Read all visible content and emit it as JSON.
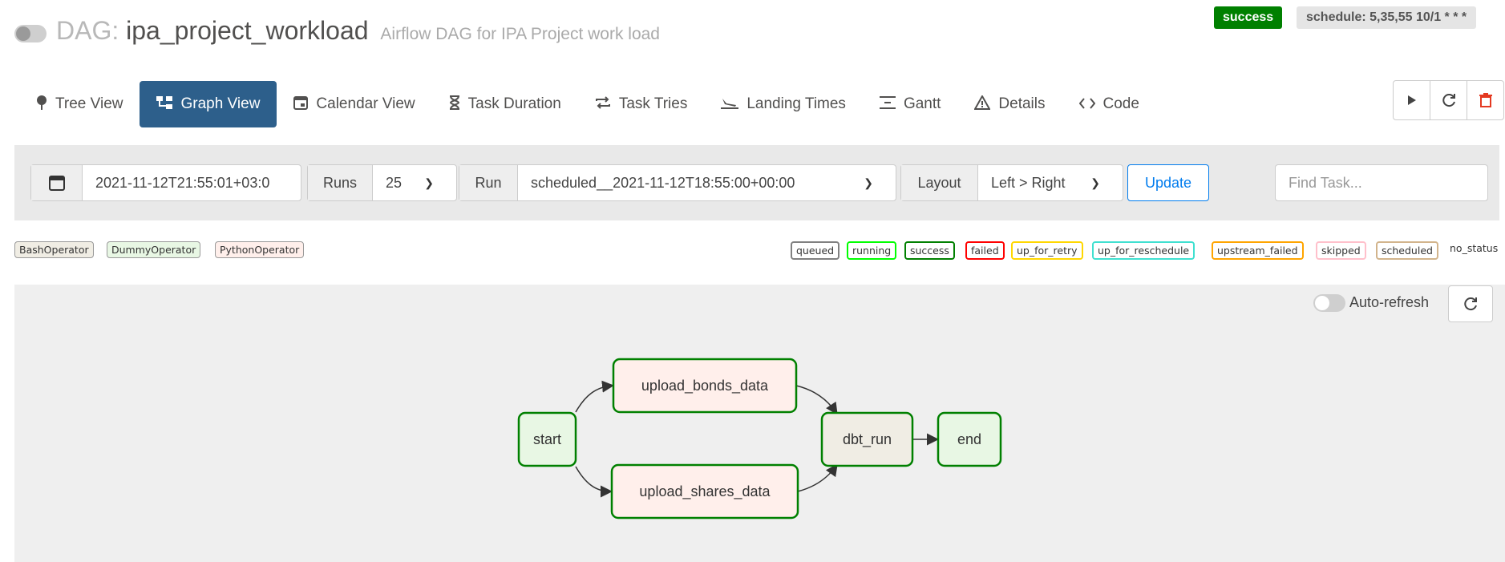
{
  "header": {
    "dag_prefix": "DAG:",
    "dag_id": "ipa_project_workload",
    "description": "Airflow DAG for IPA Project work load",
    "status_badge": "success",
    "schedule": "schedule: 5,35,55 10/1 * * *"
  },
  "nav": {
    "tabs": [
      {
        "label": "Tree View",
        "icon": "tree-icon"
      },
      {
        "label": "Graph View",
        "icon": "graph-icon",
        "active": true
      },
      {
        "label": "Calendar View",
        "icon": "calendar-icon"
      },
      {
        "label": "Task Duration",
        "icon": "hourglass-icon"
      },
      {
        "label": "Task Tries",
        "icon": "retry-icon"
      },
      {
        "label": "Landing Times",
        "icon": "landing-icon"
      },
      {
        "label": "Gantt",
        "icon": "gantt-icon"
      },
      {
        "label": "Details",
        "icon": "warning-icon"
      },
      {
        "label": "Code",
        "icon": "code-icon"
      }
    ],
    "actions": [
      "trigger-icon",
      "refresh-icon",
      "delete-icon"
    ]
  },
  "filters": {
    "date_value": "2021-11-12T21:55:01+03:0",
    "runs_label": "Runs",
    "runs_value": "25",
    "run_label": "Run",
    "run_value": "scheduled__2021-11-12T18:55:00+00:00",
    "layout_label": "Layout",
    "layout_value": "Left > Right",
    "update_label": "Update",
    "find_placeholder": "Find Task..."
  },
  "operators": [
    {
      "label": "BashOperator",
      "color": "#f0ede4"
    },
    {
      "label": "DummyOperator",
      "color": "#e8f7e4"
    },
    {
      "label": "PythonOperator",
      "color": "#ffefeb"
    }
  ],
  "states": [
    {
      "label": "queued",
      "color": "#808080"
    },
    {
      "label": "running",
      "color": "#00ff00"
    },
    {
      "label": "success",
      "color": "#008000"
    },
    {
      "label": "failed",
      "color": "#ff0000"
    },
    {
      "label": "up_for_retry",
      "color": "#ffd700"
    },
    {
      "label": "up_for_reschedule",
      "color": "#40e0d0"
    },
    {
      "label": "upstream_failed",
      "color": "#ffa500"
    },
    {
      "label": "skipped",
      "color": "#ffc0cb"
    },
    {
      "label": "scheduled",
      "color": "#d2b48c"
    }
  ],
  "no_status_label": "no_status",
  "graph": {
    "auto_refresh_label": "Auto-refresh",
    "nodes": [
      {
        "id": "start",
        "label": "start",
        "operator": "DummyOperator",
        "state": "success"
      },
      {
        "id": "upload_bonds_data",
        "label": "upload_bonds_data",
        "operator": "PythonOperator",
        "state": "success"
      },
      {
        "id": "upload_shares_data",
        "label": "upload_shares_data",
        "operator": "PythonOperator",
        "state": "success"
      },
      {
        "id": "dbt_run",
        "label": "dbt_run",
        "operator": "BashOperator",
        "state": "success"
      },
      {
        "id": "end",
        "label": "end",
        "operator": "DummyOperator",
        "state": "success"
      }
    ],
    "edges": [
      [
        "start",
        "upload_bonds_data"
      ],
      [
        "start",
        "upload_shares_data"
      ],
      [
        "upload_bonds_data",
        "dbt_run"
      ],
      [
        "upload_shares_data",
        "dbt_run"
      ],
      [
        "dbt_run",
        "end"
      ]
    ]
  }
}
